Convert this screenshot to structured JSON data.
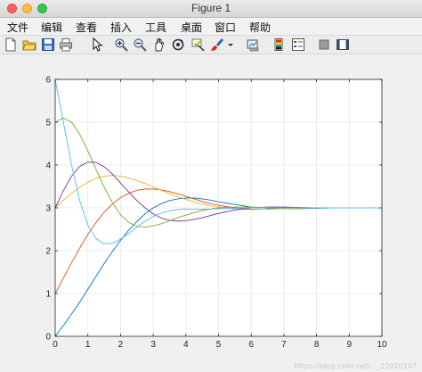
{
  "window": {
    "title": "Figure 1"
  },
  "menu": [
    "文件",
    "编辑",
    "查看",
    "插入",
    "工具",
    "桌面",
    "窗口",
    "帮助"
  ],
  "toolbar": {
    "icons": [
      "new-figure-icon",
      "open-file-icon",
      "save-icon",
      "print-icon",
      "pointer-icon",
      "zoom-in-icon",
      "zoom-out-icon",
      "pan-icon",
      "rotate-3d-icon",
      "data-cursor-icon",
      "brush-icon",
      "brush-dropdown-icon",
      "link-plot-icon",
      "insert-colorbar-icon",
      "insert-legend-icon",
      "hide-plot-tools-icon",
      "show-plot-tools-icon"
    ]
  },
  "watermark": "https://blog.csdn.net/..._22010107",
  "chart_data": {
    "type": "line",
    "xlim": [
      0,
      10
    ],
    "ylim": [
      0,
      6
    ],
    "xticks": [
      0,
      1,
      2,
      3,
      4,
      5,
      6,
      7,
      8,
      9,
      10
    ],
    "yticks": [
      0,
      1,
      2,
      3,
      4,
      5,
      6
    ],
    "grid": true,
    "x": [
      0,
      0.25,
      0.5,
      0.75,
      1,
      1.25,
      1.5,
      1.75,
      2,
      2.25,
      2.5,
      2.75,
      3,
      3.25,
      3.5,
      3.75,
      4,
      4.25,
      4.5,
      4.75,
      5,
      5.5,
      6,
      6.5,
      7,
      7.5,
      8,
      8.5,
      9,
      9.5,
      10
    ],
    "series": [
      {
        "color": "#0072BD",
        "values": [
          0,
          0.25,
          0.52,
          0.8,
          1.1,
          1.4,
          1.7,
          1.98,
          2.24,
          2.48,
          2.68,
          2.86,
          3.0,
          3.1,
          3.17,
          3.21,
          3.23,
          3.23,
          3.21,
          3.18,
          3.14,
          3.08,
          3.02,
          2.99,
          2.98,
          2.98,
          2.99,
          3.0,
          3.0,
          3.0,
          3.0
        ]
      },
      {
        "color": "#D95319",
        "values": [
          1,
          1.36,
          1.72,
          2.06,
          2.38,
          2.66,
          2.9,
          3.09,
          3.24,
          3.34,
          3.41,
          3.44,
          3.44,
          3.42,
          3.38,
          3.33,
          3.27,
          3.21,
          3.15,
          3.1,
          3.06,
          3.0,
          2.97,
          2.97,
          2.98,
          2.99,
          3.0,
          3.0,
          3.0,
          3.0,
          3.0
        ]
      },
      {
        "color": "#EDB120",
        "values": [
          3,
          3.18,
          3.34,
          3.48,
          3.6,
          3.69,
          3.74,
          3.76,
          3.74,
          3.7,
          3.64,
          3.57,
          3.49,
          3.41,
          3.33,
          3.26,
          3.2,
          3.14,
          3.09,
          3.05,
          3.02,
          2.97,
          2.96,
          2.97,
          2.98,
          2.99,
          3.0,
          3.0,
          3.0,
          3.0,
          3.0
        ]
      },
      {
        "color": "#7E2F8E",
        "values": [
          3,
          3.4,
          3.74,
          3.97,
          4.07,
          4.06,
          3.96,
          3.79,
          3.58,
          3.37,
          3.17,
          3.0,
          2.86,
          2.76,
          2.71,
          2.69,
          2.7,
          2.73,
          2.77,
          2.82,
          2.87,
          2.95,
          3.0,
          3.02,
          3.02,
          3.01,
          3.0,
          3.0,
          3.0,
          3.0,
          3.0
        ]
      },
      {
        "color": "#77AC30",
        "values": [
          5,
          5.1,
          5.0,
          4.72,
          4.33,
          3.9,
          3.48,
          3.12,
          2.84,
          2.66,
          2.57,
          2.55,
          2.58,
          2.63,
          2.7,
          2.77,
          2.83,
          2.89,
          2.94,
          2.97,
          3.0,
          3.02,
          3.02,
          3.01,
          3.0,
          3.0,
          3.0,
          3.0,
          3.0,
          3.0,
          3.0
        ]
      },
      {
        "color": "#4DBEEE",
        "values": [
          6,
          5.0,
          4.0,
          3.17,
          2.6,
          2.28,
          2.16,
          2.17,
          2.27,
          2.4,
          2.55,
          2.69,
          2.8,
          2.88,
          2.93,
          2.96,
          2.97,
          2.97,
          2.97,
          2.97,
          2.98,
          2.99,
          3.0,
          3.0,
          3.0,
          3.0,
          3.0,
          3.0,
          3.0,
          3.0,
          3.0
        ]
      }
    ]
  }
}
